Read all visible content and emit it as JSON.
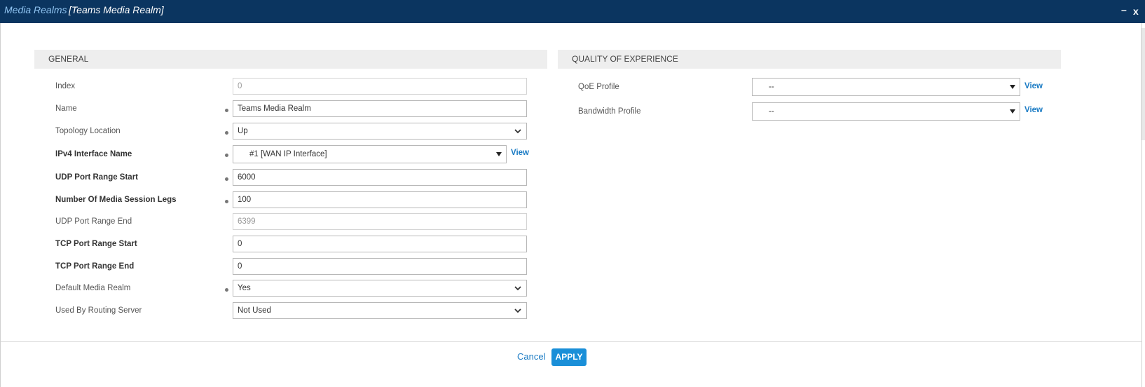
{
  "window": {
    "breadcrumb": "Media Realms",
    "title": "[Teams Media Realm]",
    "minimize_glyph": "–",
    "close_glyph": "x"
  },
  "general": {
    "heading": "GENERAL",
    "fields": {
      "index": {
        "label": "Index",
        "value": "0"
      },
      "name": {
        "label": "Name",
        "value": "Teams Media Realm"
      },
      "topology": {
        "label": "Topology Location",
        "value": "Up"
      },
      "ipv4": {
        "label": "IPv4 Interface Name",
        "value": "#1 [WAN IP Interface]",
        "link": "View"
      },
      "udp_start": {
        "label": "UDP Port Range Start",
        "value": "6000"
      },
      "legs": {
        "label": "Number Of Media Session Legs",
        "value": "100"
      },
      "udp_end": {
        "label": "UDP Port Range End",
        "value": "6399"
      },
      "tcp_start": {
        "label": "TCP Port Range Start",
        "value": "0"
      },
      "tcp_end": {
        "label": "TCP Port Range End",
        "value": "0"
      },
      "default_realm": {
        "label": "Default Media Realm",
        "value": "Yes"
      },
      "routing_server": {
        "label": "Used By Routing Server",
        "value": "Not Used"
      }
    }
  },
  "qoe": {
    "heading": "QUALITY OF EXPERIENCE",
    "fields": {
      "qoe_profile": {
        "label": "QoE Profile",
        "value": "--",
        "link": "View"
      },
      "bandwidth_profile": {
        "label": "Bandwidth Profile",
        "value": "--",
        "link": "View"
      }
    }
  },
  "footer": {
    "cancel_label": "Cancel",
    "apply_label": "APPLY"
  },
  "colors": {
    "titlebar": "#0b3560",
    "accent": "#1a8fd8",
    "link": "#1a7bc4"
  }
}
